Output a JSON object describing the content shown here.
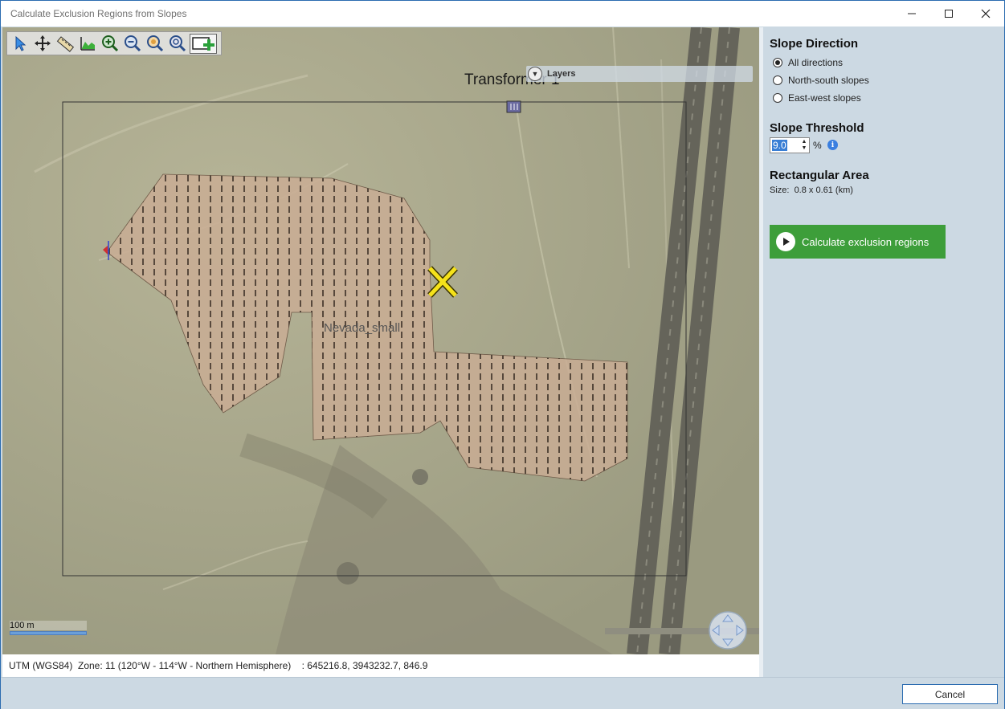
{
  "window": {
    "title": "Calculate Exclusion Regions from Slopes",
    "minimize_icon": "minimize-icon",
    "maximize_icon": "maximize-icon",
    "close_icon": "close-icon"
  },
  "map": {
    "toolbar": [
      "pointer-icon",
      "pan-icon",
      "ruler-icon",
      "elevation-profile-icon",
      "zoom-in-icon",
      "zoom-out-icon",
      "zoom-extent-icon",
      "zoom-selection-icon",
      "add-rectangle-icon"
    ],
    "layers_label": "Layers",
    "transformer_label": "Transformer 1",
    "region_label": "Nevada_small",
    "scale_label": "100 m",
    "colors": {
      "region_fill": "#c9ad94",
      "region_stroke": "#6e5a48",
      "marker": "#f5e21a",
      "frame": "#333333"
    }
  },
  "status": {
    "coords_text": "UTM (WGS84)  Zone: 11 (120°W - 114°W - Northern Hemisphere)    : 645216.8, 3943232.7, 846.9"
  },
  "panel": {
    "slope_direction": {
      "title": "Slope Direction",
      "options": [
        {
          "label": "All directions",
          "selected": true
        },
        {
          "label": "North-south slopes",
          "selected": false
        },
        {
          "label": "East-west slopes",
          "selected": false
        }
      ]
    },
    "slope_threshold": {
      "title": "Slope Threshold",
      "value": "9.0",
      "unit": "%"
    },
    "rectangular_area": {
      "title": "Rectangular Area",
      "size_text": "Size:  0.8 x 0.61 (km)"
    },
    "calculate_label": "Calculate exclusion regions",
    "calculate_color": "#3d9e3a"
  },
  "footer": {
    "cancel_label": "Cancel"
  }
}
